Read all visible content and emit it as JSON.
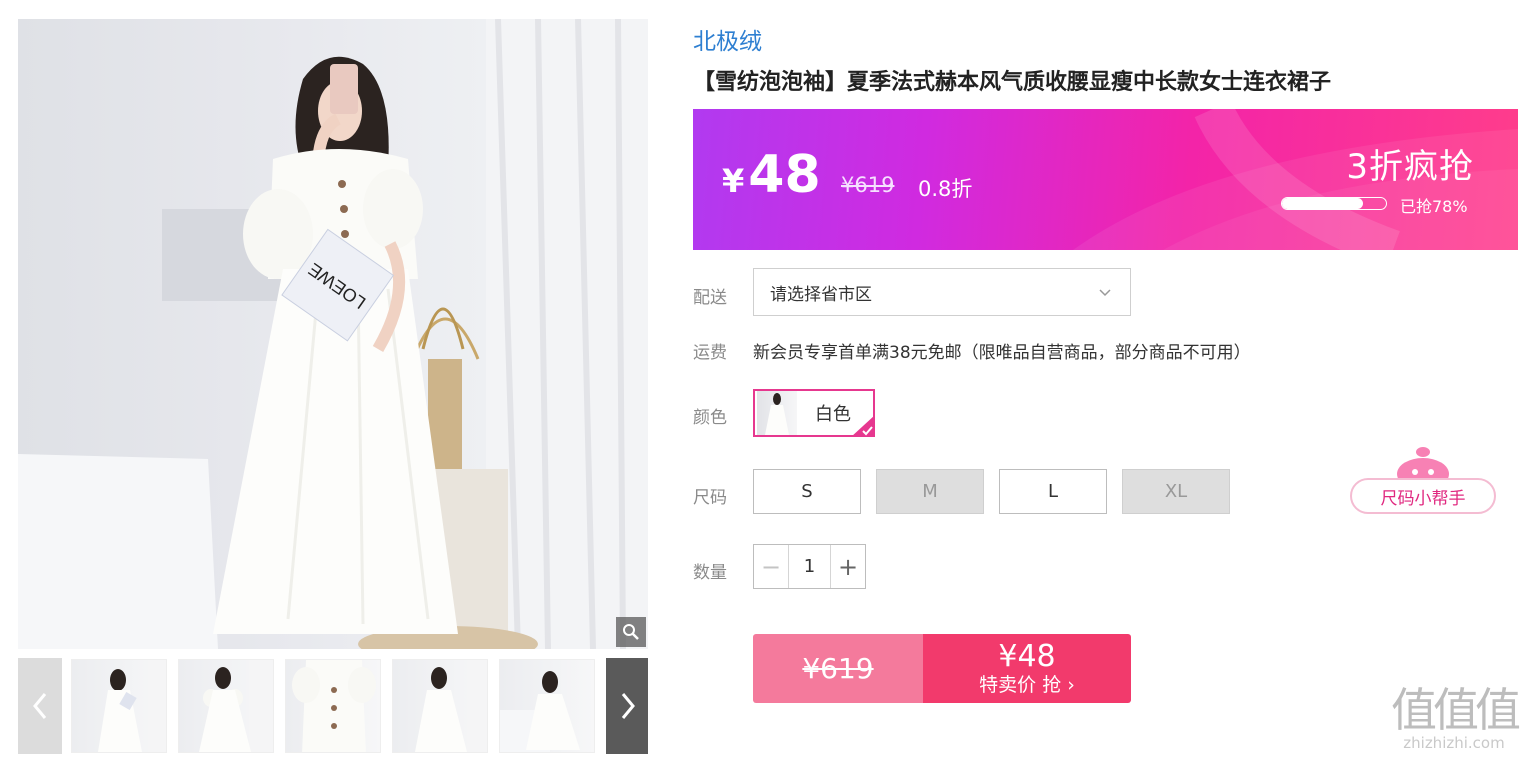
{
  "gallery": {
    "zoom_icon": "magnifier-icon",
    "prev_icon": "chevron-left-icon",
    "next_icon": "chevron-right-icon",
    "main_image_sign_text": "LOEWE",
    "thumbnail_count": 5
  },
  "product": {
    "brand": "北极绒",
    "title": "【雪纺泡泡袖】夏季法式赫本风气质收腰显瘦中长款女士连衣裙子"
  },
  "price_banner": {
    "currency": "¥",
    "price": "48",
    "original_price": "¥619",
    "discount": "0.8折",
    "promo_label": "3折疯抢",
    "sold_fraction": 0.78,
    "sold_text": "已抢78%",
    "colors": {
      "start": "#b13af0",
      "end": "#ff3d8b"
    }
  },
  "delivery": {
    "label": "配送",
    "placeholder": "请选择省市区",
    "icon": "chevron-down-icon"
  },
  "shipping": {
    "label": "运费",
    "text": "新会员专享首单满38元免邮（限唯品自营商品，部分商品不可用）"
  },
  "color": {
    "label": "颜色",
    "options": [
      {
        "name": "白色",
        "selected": true
      }
    ],
    "accent": "#e6388f"
  },
  "size": {
    "label": "尺码",
    "options": [
      {
        "name": "S",
        "available": true
      },
      {
        "name": "M",
        "available": false
      },
      {
        "name": "L",
        "available": true
      },
      {
        "name": "XL",
        "available": false
      }
    ],
    "helper": "尺码小帮手"
  },
  "quantity": {
    "label": "数量",
    "value": "1",
    "minus": "−",
    "plus": "+"
  },
  "buy": {
    "original_price": "¥619",
    "price": "¥48",
    "action": "特卖价 抢 ›",
    "colors": {
      "left": "#f47a9c",
      "right": "#f23a6c"
    }
  },
  "watermark": {
    "logo": "值值值",
    "domain": "zhizhizhi.com"
  }
}
